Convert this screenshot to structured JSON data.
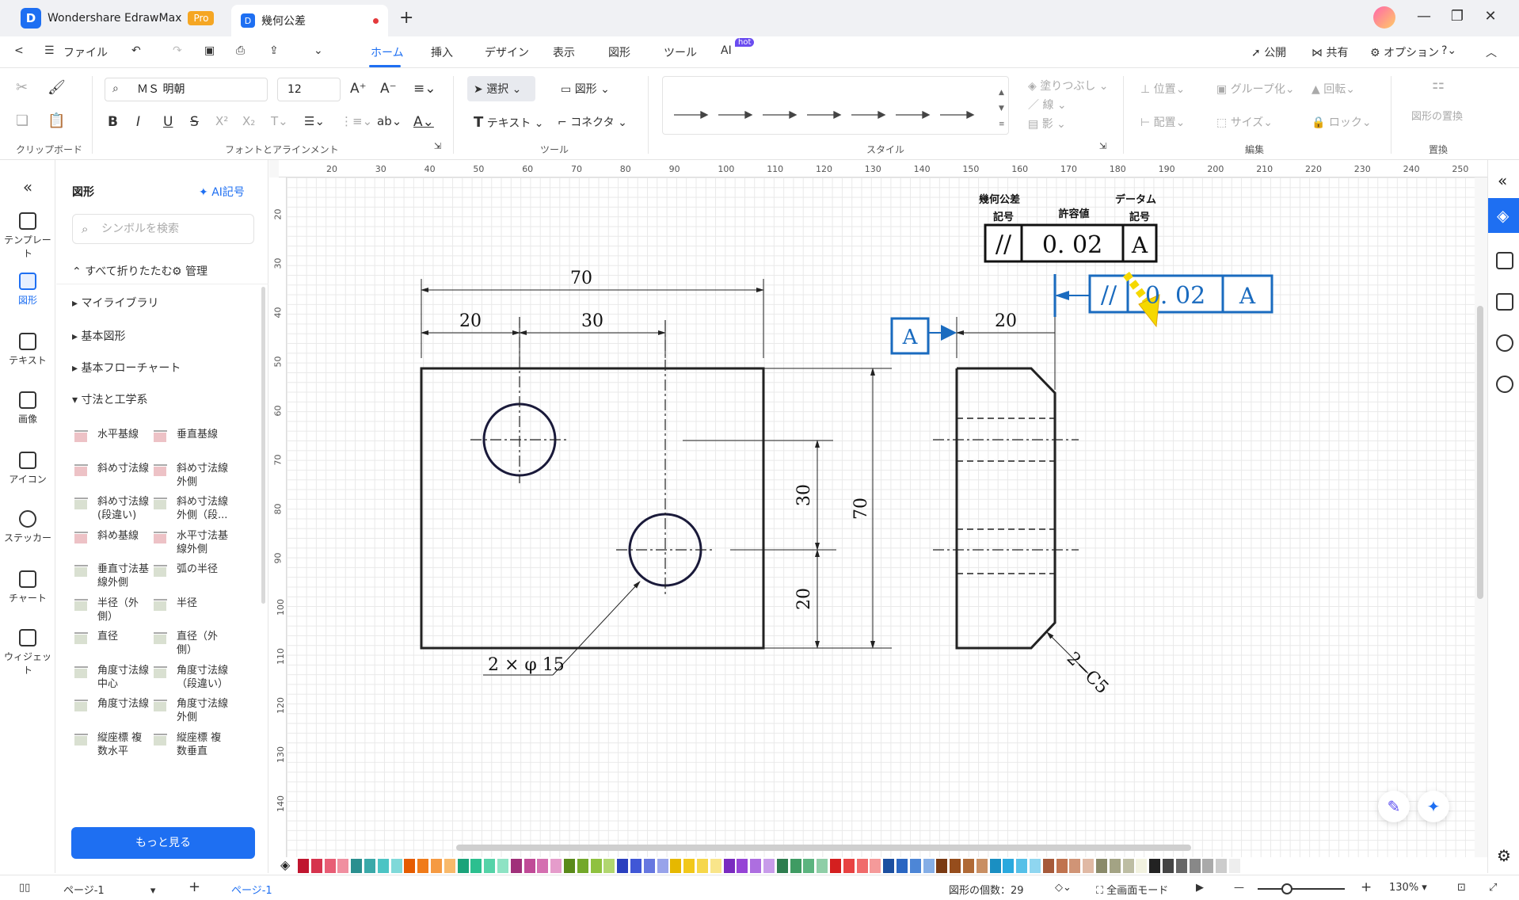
{
  "app": {
    "name": "Wondershare EdrawMax",
    "badge": "Pro",
    "doc_tab": "幾何公差"
  },
  "menu": {
    "back": "<",
    "file": "ファイル",
    "items": [
      "ホーム",
      "挿入",
      "デザイン",
      "表示",
      "図形",
      "ツール",
      "AI"
    ],
    "hot": "hot",
    "publish": "公開",
    "share": "共有",
    "options": "オプション"
  },
  "ribbon": {
    "font": "ＭＳ 明朝",
    "size": "12",
    "select": "選択",
    "shape": "図形",
    "text": "テキスト",
    "connector": "コネクタ",
    "fill": "塗りつぶし",
    "line": "線",
    "shadow": "影",
    "position": "位置",
    "group": "グループ化",
    "rotate": "回転",
    "align": "配置",
    "size_btn": "サイズ",
    "lock": "ロック",
    "replace": "図形の置換",
    "groups": {
      "clipboard": "クリップボード",
      "font": "フォントとアラインメント",
      "tools": "ツール",
      "style": "スタイル",
      "edit": "編集",
      "replace": "置換"
    }
  },
  "rail": [
    "テンプレート",
    "図形",
    "テキスト",
    "画像",
    "アイコン",
    "ステッカー",
    "チャート",
    "ウィジェット"
  ],
  "panel": {
    "title": "図形",
    "ai": "AI記号",
    "search_placeholder": "シンボルを検索",
    "collapse": "すべて折りたたむ",
    "manage": "管理",
    "categories": [
      "マイライブラリ",
      "基本図形",
      "基本フローチャート",
      "寸法と工学系"
    ],
    "shapes": [
      [
        "水平基線",
        "垂直基線"
      ],
      [
        "斜め寸法線",
        "斜め寸法線\n外側"
      ],
      [
        "斜め寸法線\n(段違い)",
        "斜め寸法線\n外側（段..."
      ],
      [
        "斜め基線",
        "水平寸法基\n線外側"
      ],
      [
        "垂直寸法基\n線外側",
        "弧の半径"
      ],
      [
        "半径（外\n側）",
        "半径"
      ],
      [
        "直径",
        "直径（外\n側）"
      ],
      [
        "角度寸法線\n中心",
        "角度寸法線\n（段違い）"
      ],
      [
        "角度寸法線",
        "角度寸法線\n外側"
      ],
      [
        "縦座標 複\n数水平",
        "縦座標 複\n数垂直"
      ]
    ],
    "more": "もっと見る"
  },
  "ruler_top": [
    "20",
    "30",
    "40",
    "50",
    "60",
    "70",
    "80",
    "90",
    "100",
    "110",
    "120",
    "130",
    "140",
    "150",
    "160",
    "170",
    "180",
    "190",
    "200",
    "210",
    "220",
    "230",
    "240",
    "250"
  ],
  "ruler_left": [
    "20",
    "30",
    "40",
    "50",
    "60",
    "70",
    "80",
    "90",
    "100",
    "110",
    "120",
    "130",
    "140"
  ],
  "drawing": {
    "legend_h1": "幾何公差",
    "legend_h1b": "記号",
    "legend_h2": "許容値",
    "legend_h3": "データム",
    "legend_h3b": "記号",
    "fcf_symbol": "//",
    "fcf_value": "0. 02",
    "fcf_datum": "A",
    "dim_70": "70",
    "dim_20": "20",
    "dim_30": "30",
    "dim_30v": "30",
    "dim_70v": "70",
    "dim_20v": "20",
    "dim_side_20": "20",
    "datum_label": "A",
    "hole_note": "2 × φ 15",
    "chamfer_note": "2−C5"
  },
  "status": {
    "page_sel": "ページ-1",
    "page_tab": "ページ-1",
    "count_label": "図形の個数：",
    "count": "29",
    "fullscreen": "全画面モード",
    "zoom": "130%"
  },
  "colors": {
    "accent": "#1e6ff2",
    "blue_drawing": "#1a6bbf",
    "yellow_arrow": "#f5d800"
  }
}
